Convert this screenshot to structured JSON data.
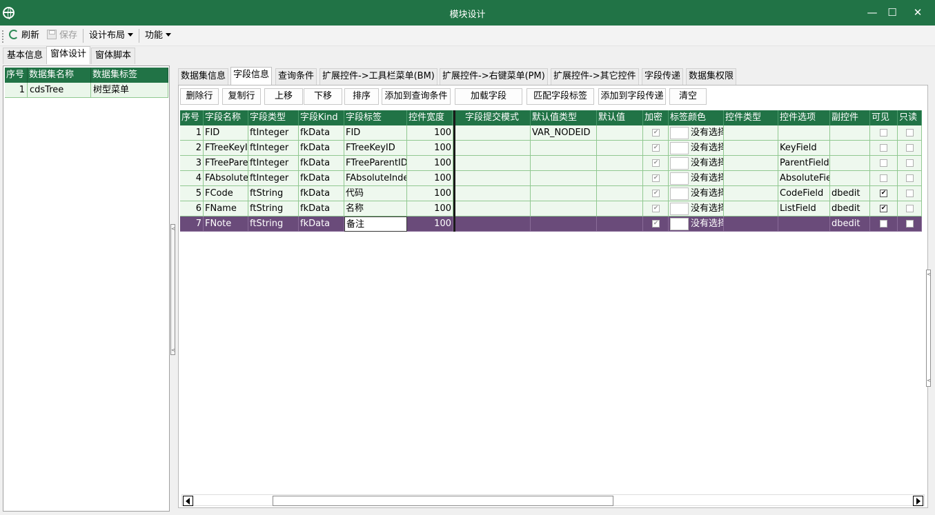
{
  "window": {
    "title": "模块设计"
  },
  "colors": {
    "accent": "#217346",
    "selected_row": "#6a4b7a",
    "row_bg": "#eef8ee",
    "grid_line": "#90c890"
  },
  "toolbar": {
    "refresh": "刷新",
    "save": "保存",
    "layout": "设计布局",
    "function": "功能"
  },
  "main_tabs": [
    "基本信息",
    "窗体设计",
    "窗体脚本"
  ],
  "left_grid": {
    "headers": [
      "序号",
      "数据集名称",
      "数据集标签"
    ],
    "rows": [
      {
        "no": "1",
        "name": "cdsTree",
        "label": "树型菜单"
      }
    ]
  },
  "sub_tabs": [
    "数据集信息",
    "字段信息",
    "查询条件",
    "扩展控件->工具栏菜单(BM)",
    "扩展控件->右键菜单(PM)",
    "扩展控件->其它控件",
    "字段传递",
    "数据集权限"
  ],
  "actions": [
    "删除行",
    "复制行",
    "上移",
    "下移",
    "排序",
    "添加到查询条件",
    "加载字段",
    "匹配字段标签",
    "添加到字段传递",
    "清空"
  ],
  "field_grid": {
    "headers": [
      "序号",
      "字段名称",
      "字段类型",
      "字段Kind",
      "字段标签",
      "控件宽度",
      "字段提交模式",
      "默认值类型",
      "默认值",
      "加密",
      "标签颜色",
      "控件类型",
      "控件选项",
      "副控件",
      "可见",
      "只读"
    ],
    "rows": [
      {
        "no": "1",
        "name": "FID",
        "type": "ftInteger",
        "kind": "fkData",
        "label": "FID",
        "width": "100",
        "submit": "",
        "default_type": "VAR_NODEID",
        "default": "",
        "encrypt": true,
        "color_text": "没有选择",
        "ctrl_type": "",
        "ctrl_option": "",
        "sub_ctrl": "",
        "visible": false,
        "readonly": false
      },
      {
        "no": "2",
        "name": "FTreeKeyID",
        "type": "ftInteger",
        "kind": "fkData",
        "label": "FTreeKeyID",
        "width": "100",
        "submit": "",
        "default_type": "",
        "default": "",
        "encrypt": true,
        "color_text": "没有选择",
        "ctrl_type": "",
        "ctrl_option": "KeyField",
        "sub_ctrl": "",
        "visible": false,
        "readonly": false
      },
      {
        "no": "3",
        "name": "FTreeParentID",
        "type": "ftInteger",
        "kind": "fkData",
        "label": "FTreeParentID",
        "width": "100",
        "submit": "",
        "default_type": "",
        "default": "",
        "encrypt": true,
        "color_text": "没有选择",
        "ctrl_type": "",
        "ctrl_option": "ParentField",
        "sub_ctrl": "",
        "visible": false,
        "readonly": false
      },
      {
        "no": "4",
        "name": "FAbsoluteIndex",
        "type": "ftInteger",
        "kind": "fkData",
        "label": "FAbsoluteIndex",
        "width": "100",
        "submit": "",
        "default_type": "",
        "default": "",
        "encrypt": true,
        "color_text": "没有选择",
        "ctrl_type": "",
        "ctrl_option": "AbsoluteField",
        "sub_ctrl": "",
        "visible": false,
        "readonly": false
      },
      {
        "no": "5",
        "name": "FCode",
        "type": "ftString",
        "kind": "fkData",
        "label": "代码",
        "width": "100",
        "submit": "",
        "default_type": "",
        "default": "",
        "encrypt": true,
        "color_text": "没有选择",
        "ctrl_type": "",
        "ctrl_option": "CodeField",
        "sub_ctrl": "dbedit",
        "visible": true,
        "readonly": false
      },
      {
        "no": "6",
        "name": "FName",
        "type": "ftString",
        "kind": "fkData",
        "label": "名称",
        "width": "100",
        "submit": "",
        "default_type": "",
        "default": "",
        "encrypt": true,
        "color_text": "没有选择",
        "ctrl_type": "",
        "ctrl_option": "ListField",
        "sub_ctrl": "dbedit",
        "visible": true,
        "readonly": false
      },
      {
        "no": "7",
        "name": "FNote",
        "type": "ftString",
        "kind": "fkData",
        "label": "备注",
        "width": "100",
        "submit": "",
        "default_type": "",
        "default": "",
        "encrypt": true,
        "color_text": "没有选择",
        "ctrl_type": "",
        "ctrl_option": "",
        "sub_ctrl": "dbedit",
        "visible": false,
        "readonly": false
      }
    ]
  }
}
